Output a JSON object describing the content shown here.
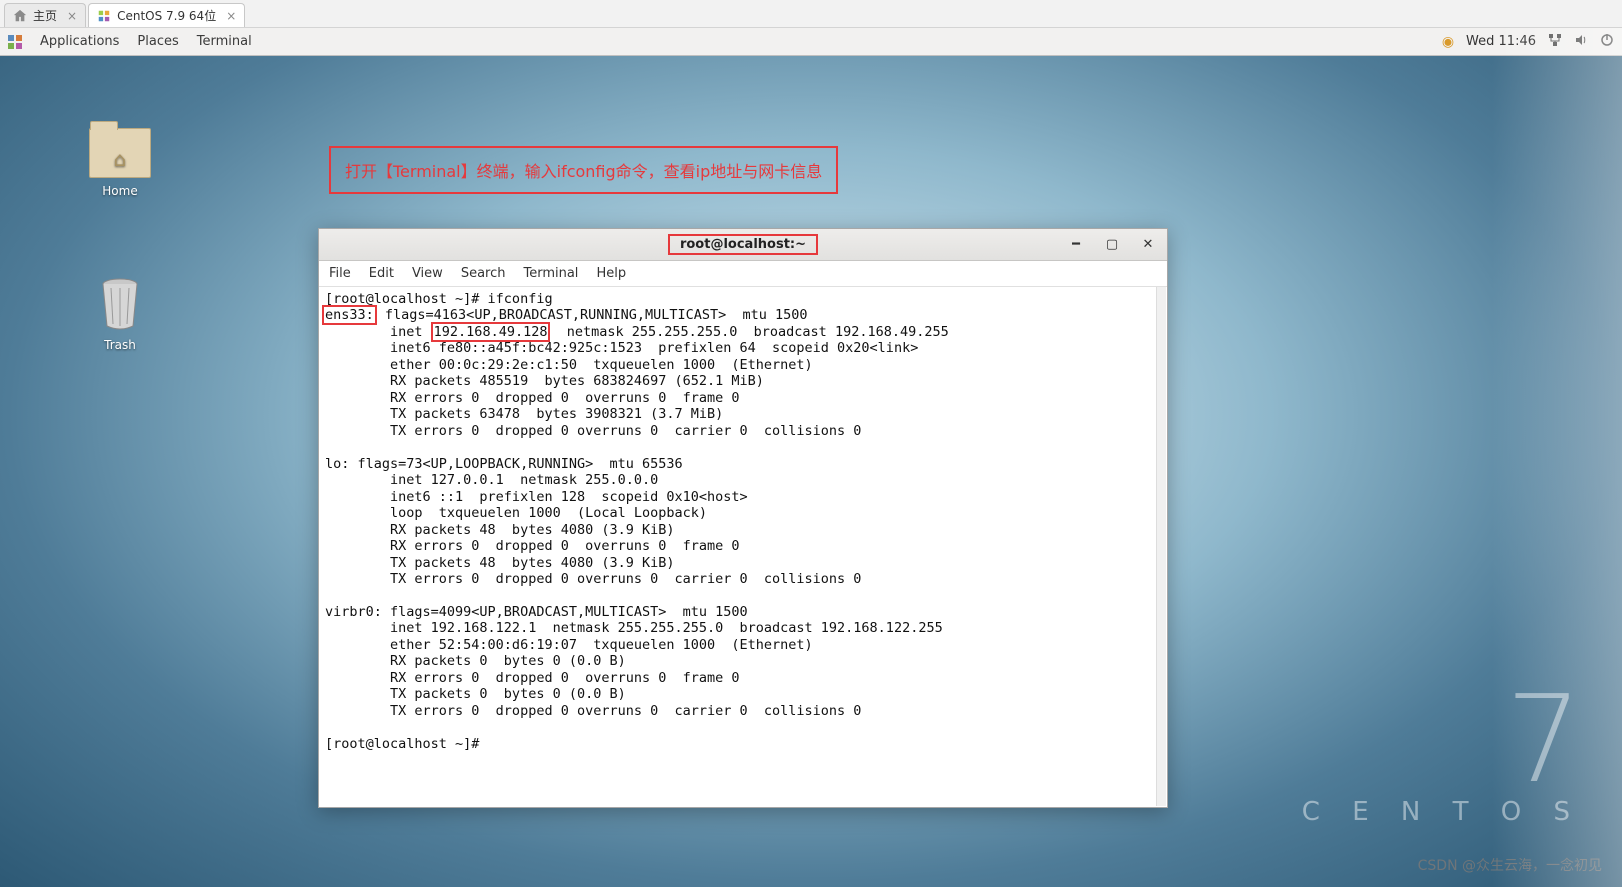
{
  "vm_tabs": {
    "home": "主页",
    "centos": "CentOS 7.9 64位"
  },
  "gnome": {
    "applications": "Applications",
    "places": "Places",
    "terminal": "Terminal",
    "clock": "Wed 11:46"
  },
  "desktop_icons": {
    "home": "Home",
    "trash": "Trash"
  },
  "annotation": "打开【Terminal】终端，输入ifconfig命令，查看ip地址与网卡信息",
  "terminal_window": {
    "title": "root@localhost:~",
    "menu": {
      "file": "File",
      "edit": "Edit",
      "view": "View",
      "search": "Search",
      "terminal": "Terminal",
      "help": "Help"
    }
  },
  "terminal": {
    "prompt1": "[root@localhost ~]# ifconfig",
    "ens33_label": "ens33:",
    "ens33_flags": " flags=4163<UP,BROADCAST,RUNNING,MULTICAST>  mtu 1500",
    "inet_prefix": "        inet ",
    "ip_address": "192.168.49.128",
    "inet_suffix": "  netmask 255.255.255.0  broadcast 192.168.49.255",
    "ens33_rest": "        inet6 fe80::a45f:bc42:925c:1523  prefixlen 64  scopeid 0x20<link>\n        ether 00:0c:29:2e:c1:50  txqueuelen 1000  (Ethernet)\n        RX packets 485519  bytes 683824697 (652.1 MiB)\n        RX errors 0  dropped 0  overruns 0  frame 0\n        TX packets 63478  bytes 3908321 (3.7 MiB)\n        TX errors 0  dropped 0 overruns 0  carrier 0  collisions 0",
    "lo_block": "lo: flags=73<UP,LOOPBACK,RUNNING>  mtu 65536\n        inet 127.0.0.1  netmask 255.0.0.0\n        inet6 ::1  prefixlen 128  scopeid 0x10<host>\n        loop  txqueuelen 1000  (Local Loopback)\n        RX packets 48  bytes 4080 (3.9 KiB)\n        RX errors 0  dropped 0  overruns 0  frame 0\n        TX packets 48  bytes 4080 (3.9 KiB)\n        TX errors 0  dropped 0 overruns 0  carrier 0  collisions 0",
    "virbr0_block": "virbr0: flags=4099<UP,BROADCAST,MULTICAST>  mtu 1500\n        inet 192.168.122.1  netmask 255.255.255.0  broadcast 192.168.122.255\n        ether 52:54:00:d6:19:07  txqueuelen 1000  (Ethernet)\n        RX packets 0  bytes 0 (0.0 B)\n        RX errors 0  dropped 0  overruns 0  frame 0\n        TX packets 0  bytes 0 (0.0 B)\n        TX errors 0  dropped 0 overruns 0  carrier 0  collisions 0",
    "prompt2": "[root@localhost ~]# "
  },
  "watermark": {
    "seven": "7",
    "centos": "C E N T O S",
    "csdn": "CSDN @众生云海，一念初见"
  }
}
